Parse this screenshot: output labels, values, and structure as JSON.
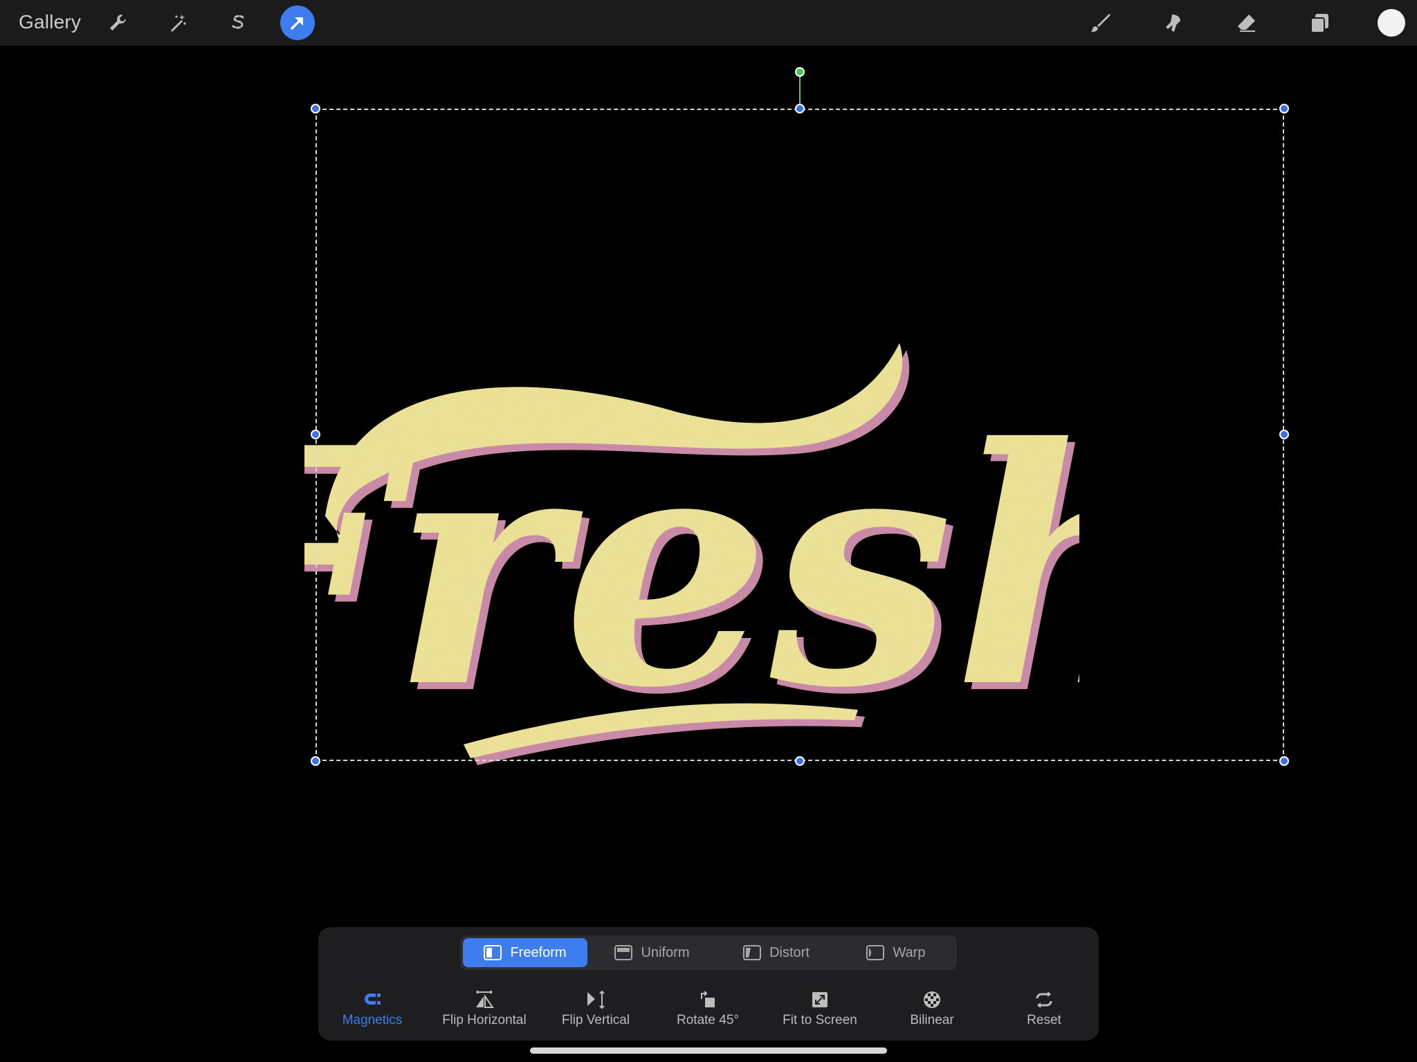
{
  "topbar": {
    "gallery_label": "Gallery",
    "left_icons": [
      "wrench-icon",
      "magic-wand-icon",
      "selection-s-icon",
      "transform-arrow-icon"
    ],
    "right_icons": [
      "brush-icon",
      "smudge-icon",
      "eraser-icon",
      "layers-icon",
      "color-icon"
    ],
    "active_color": "#f2f2f2"
  },
  "canvas": {
    "artwork_text": "Fresh",
    "fill_color": "#f2e79a",
    "shadow_color": "#c98aa8"
  },
  "transform_modes": {
    "items": [
      {
        "label": "Freeform",
        "icon": "freeform-icon",
        "active": true
      },
      {
        "label": "Uniform",
        "icon": "uniform-icon",
        "active": false
      },
      {
        "label": "Distort",
        "icon": "distort-icon",
        "active": false
      },
      {
        "label": "Warp",
        "icon": "warp-icon",
        "active": false
      }
    ]
  },
  "tools": {
    "items": [
      {
        "label": "Magnetics",
        "icon": "magnet-icon",
        "active": true
      },
      {
        "label": "Flip Horizontal",
        "icon": "flip-horizontal-icon",
        "active": false
      },
      {
        "label": "Flip Vertical",
        "icon": "flip-vertical-icon",
        "active": false
      },
      {
        "label": "Rotate 45°",
        "icon": "rotate-icon",
        "active": false
      },
      {
        "label": "Fit to Screen",
        "icon": "fit-screen-icon",
        "active": false
      },
      {
        "label": "Bilinear",
        "icon": "bilinear-icon",
        "active": false
      },
      {
        "label": "Reset",
        "icon": "reset-icon",
        "active": false
      }
    ]
  },
  "colors": {
    "accent": "#3d7df0",
    "topbar_bg": "#1b1b1c",
    "panel_bg": "#1e1e20"
  }
}
